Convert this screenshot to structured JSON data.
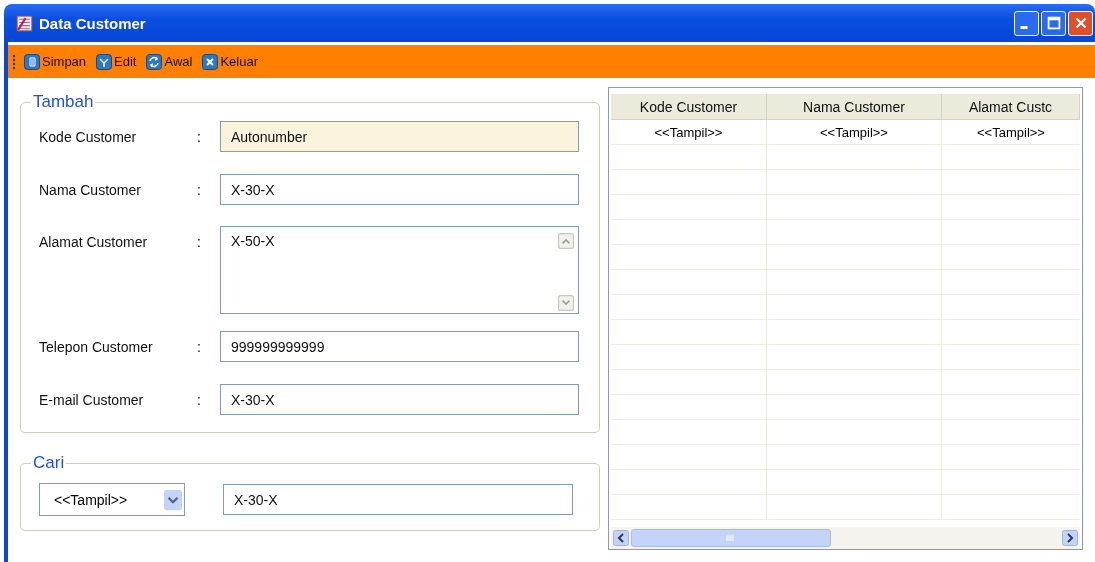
{
  "window": {
    "title": "Data Customer"
  },
  "toolbar": [
    {
      "label": "Simpan",
      "kind": "save"
    },
    {
      "label": "Edit",
      "kind": "edit"
    },
    {
      "label": "Awal",
      "kind": "refresh"
    },
    {
      "label": "Keluar",
      "kind": "exit"
    }
  ],
  "tambah": {
    "title": "Tambah",
    "fields": [
      {
        "label": "Kode Customer",
        "colon": ":",
        "value": "Autonumber",
        "kind": "readonly"
      },
      {
        "label": "Nama Customer",
        "colon": ":",
        "value": "X-30-X",
        "kind": "text"
      },
      {
        "label": "Alamat Customer",
        "colon": ":",
        "value": "X-50-X",
        "kind": "textarea"
      },
      {
        "label": "Telepon Customer",
        "colon": ":",
        "value": "999999999999",
        "kind": "text"
      },
      {
        "label": "E-mail Customer",
        "colon": ":",
        "value": "X-30-X",
        "kind": "text"
      }
    ]
  },
  "cari": {
    "title": "Cari",
    "select": "<<Tampil>>",
    "value": "X-30-X"
  },
  "table": {
    "columns": [
      "Kode Customer",
      "Nama Customer",
      "Alamat Custc"
    ],
    "rows": [
      [
        "<<Tampil>>",
        "<<Tampil>>",
        "<<Tampil>>"
      ]
    ]
  }
}
